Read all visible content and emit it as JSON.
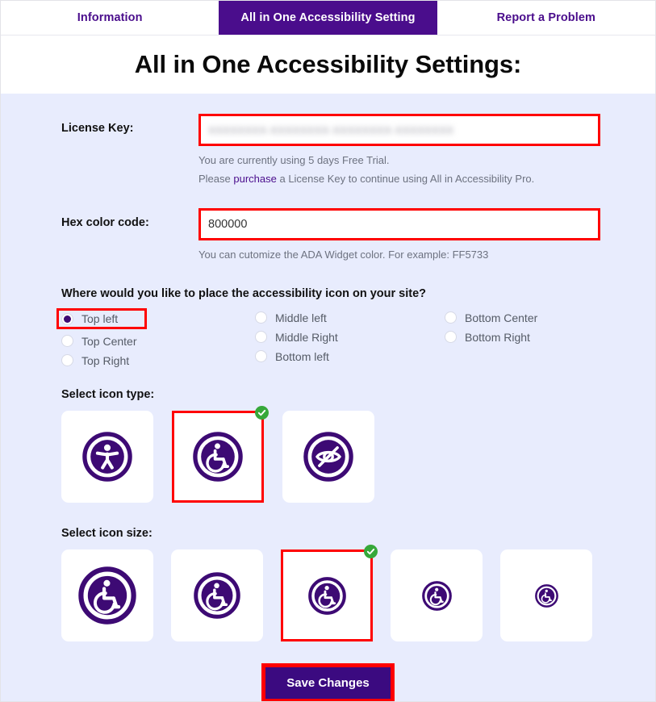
{
  "tabs": [
    {
      "label": "Information",
      "active": false
    },
    {
      "label": "All in One Accessibility Setting",
      "active": true
    },
    {
      "label": "Report a Problem",
      "active": false
    }
  ],
  "header": {
    "title": "All in One Accessibility Settings:"
  },
  "license": {
    "label": "License Key:",
    "value": "XXXXXXXX-XXXXXXXX-XXXXXXXX-XXXXXXXX",
    "placeholder": "License Key",
    "trial_text": "You are currently using 5 days Free Trial.",
    "purchase_prefix": "Please ",
    "purchase_link": "purchase",
    "purchase_suffix": " a License Key to continue using All in Accessibility Pro."
  },
  "hex": {
    "label": "Hex color code:",
    "value": "800000",
    "placeholder": "Hex color code",
    "help": "You can cutomize the ADA Widget color. For example: FF5733"
  },
  "placement": {
    "heading": "Where would you like to place the accessibility icon on your site?",
    "columns": [
      [
        {
          "label": "Top left",
          "selected": true,
          "highlighted": true
        },
        {
          "label": "Top Center",
          "selected": false,
          "highlighted": false
        },
        {
          "label": "Top Right",
          "selected": false,
          "highlighted": false
        }
      ],
      [
        {
          "label": "Middle left",
          "selected": false,
          "highlighted": false
        },
        {
          "label": "Middle Right",
          "selected": false,
          "highlighted": false
        },
        {
          "label": "Bottom left",
          "selected": false,
          "highlighted": false
        }
      ],
      [
        {
          "label": "Bottom Center",
          "selected": false,
          "highlighted": false
        },
        {
          "label": "Bottom Right",
          "selected": false,
          "highlighted": false
        }
      ]
    ]
  },
  "icon_type": {
    "heading": "Select icon type:",
    "options": [
      {
        "icon": "accessibility-person-icon",
        "selected": false,
        "size": 62
      },
      {
        "icon": "wheelchair-icon",
        "selected": true,
        "size": 62
      },
      {
        "icon": "eye-slash-icon",
        "selected": false,
        "size": 62
      }
    ]
  },
  "icon_size": {
    "heading": "Select icon size:",
    "options": [
      {
        "icon": "wheelchair-icon",
        "selected": false,
        "size": 72
      },
      {
        "icon": "wheelchair-icon",
        "selected": false,
        "size": 58
      },
      {
        "icon": "wheelchair-icon",
        "selected": true,
        "size": 47
      },
      {
        "icon": "wheelchair-icon",
        "selected": false,
        "size": 37
      },
      {
        "icon": "wheelchair-icon",
        "selected": false,
        "size": 29
      }
    ]
  },
  "save": {
    "label": "Save Changes"
  },
  "colors": {
    "accent_purple": "#4a0d8c",
    "icon_purple": "#3d0a74",
    "panel_background": "#e8ecfd",
    "highlight_red": "#ff0000",
    "check_green": "#36a83a",
    "save_button": "#3b0a80"
  }
}
